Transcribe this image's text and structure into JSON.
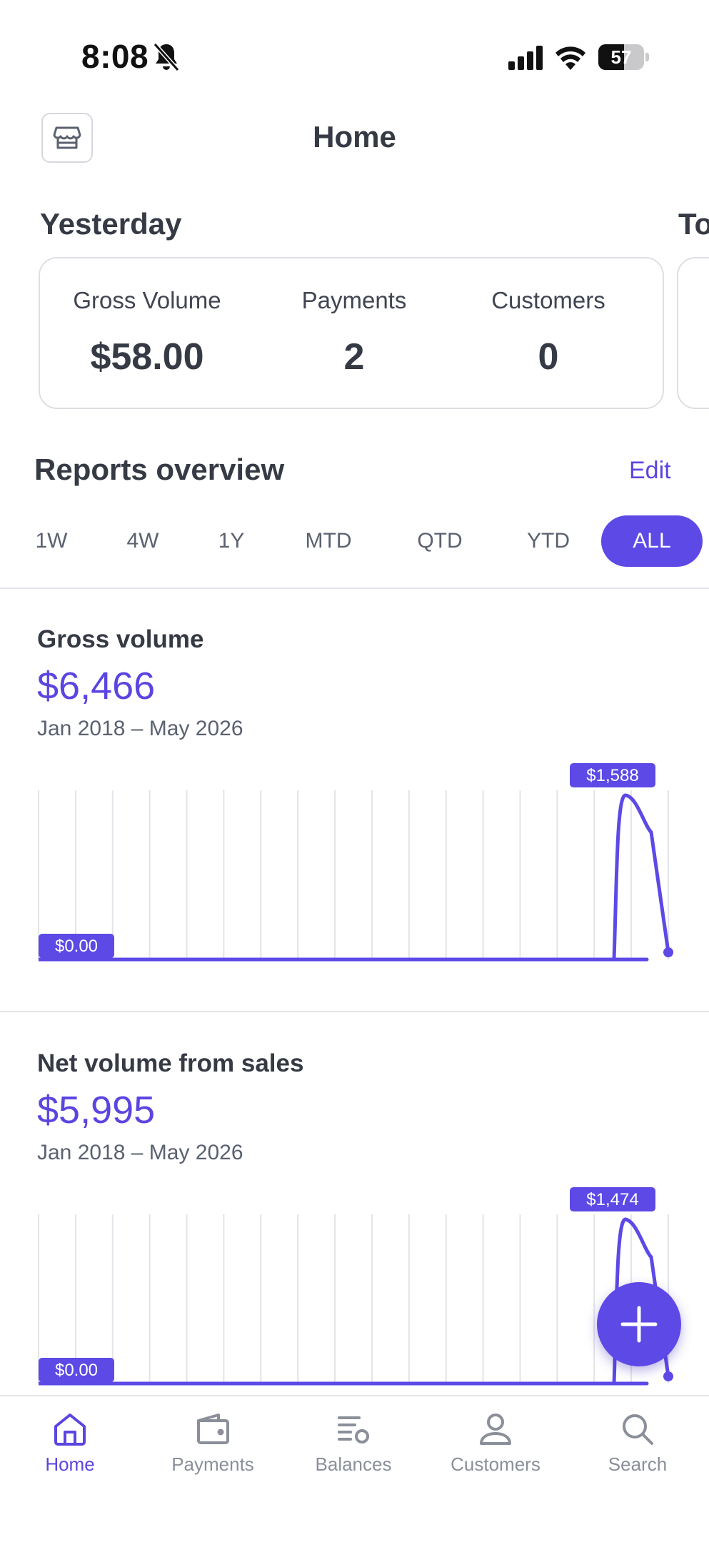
{
  "status_bar": {
    "time": "8:08",
    "battery": "57",
    "battery_level": 0.57
  },
  "header": {
    "title": "Home"
  },
  "yesterday": {
    "heading": "Yesterday",
    "metrics": [
      {
        "label": "Gross Volume",
        "value": "$58.00"
      },
      {
        "label": "Payments",
        "value": "2"
      },
      {
        "label": "Customers",
        "value": "0"
      }
    ],
    "next_heading": "To"
  },
  "reports": {
    "heading": "Reports overview",
    "edit_label": "Edit",
    "ranges": [
      "1W",
      "4W",
      "1Y",
      "MTD",
      "QTD",
      "YTD",
      "ALL"
    ],
    "active_range": "ALL"
  },
  "report_cards": [
    {
      "title": "Gross volume",
      "value": "$6,466",
      "range": "Jan 2018 – May 2026",
      "chart_data": {
        "type": "line",
        "max_label": "$1,588",
        "min_label": "$0.00",
        "values": [
          0,
          0,
          0,
          0,
          0,
          0,
          0,
          0,
          0,
          0,
          0,
          0,
          0,
          0,
          0,
          0,
          1588,
          1300,
          0
        ],
        "ylim": [
          0,
          1588
        ],
        "grid": true
      }
    },
    {
      "title": "Net volume from sales",
      "value": "$5,995",
      "range": "Jan 2018 – May 2026",
      "chart_data": {
        "type": "line",
        "max_label": "$1,474",
        "min_label": "$0.00",
        "values": [
          0,
          0,
          0,
          0,
          0,
          0,
          0,
          0,
          0,
          0,
          0,
          0,
          0,
          0,
          0,
          0,
          1474,
          1200,
          0
        ],
        "ylim": [
          0,
          1474
        ],
        "grid": true
      }
    }
  ],
  "tabs": [
    {
      "label": "Home",
      "icon": "home-icon",
      "active": true
    },
    {
      "label": "Payments",
      "icon": "wallet-icon",
      "active": false
    },
    {
      "label": "Balances",
      "icon": "balances-icon",
      "active": false
    },
    {
      "label": "Customers",
      "icon": "person-icon",
      "active": false
    },
    {
      "label": "Search",
      "icon": "search-icon",
      "active": false
    }
  ],
  "colors": {
    "accent": "#5c49e6",
    "text": "#353a44",
    "muted": "#8a8f99",
    "grid": "#e1e4e8"
  }
}
